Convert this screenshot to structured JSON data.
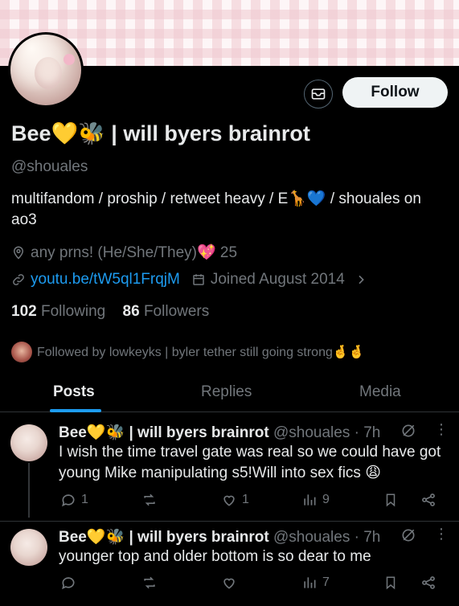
{
  "profile": {
    "display_name": "Bee💛🐝 | will byers brainrot",
    "handle": "@shouales",
    "bio": "multifandom / proship / retweet heavy / E🦒💙 / shouales on ao3",
    "location": "any prns! (He/She/They)💖 25",
    "link": "youtu.be/tW5ql1FrqjM",
    "joined": "Joined August 2014",
    "following_count": "102",
    "following_label": "Following",
    "followers_count": "86",
    "followers_label": "Followers",
    "followed_by": "Followed by lowkeyks | byler tether still going strong🤞🤞"
  },
  "header": {
    "follow_label": "Follow"
  },
  "tabs": [
    "Posts",
    "Replies",
    "Media"
  ],
  "posts": [
    {
      "name": "Bee💛🐝 | will byers brainrot",
      "meta": "@shouales · 7h",
      "text": "I wish the time travel gate was real so we could have got young Mike manipulating s5!Will into sex fics 😩",
      "replies": "1",
      "retweets": "",
      "likes": "1",
      "views": "9"
    },
    {
      "name": "Bee💛🐝 | will byers brainrot",
      "meta": "@shouales · 7h",
      "text": "younger top and older bottom is so dear to me",
      "replies": "",
      "retweets": "",
      "likes": "",
      "views": "7"
    }
  ],
  "colors": {
    "accent": "#1d9bf0",
    "muted": "#71767b",
    "text": "#e7e9ea",
    "background": "#000000"
  }
}
